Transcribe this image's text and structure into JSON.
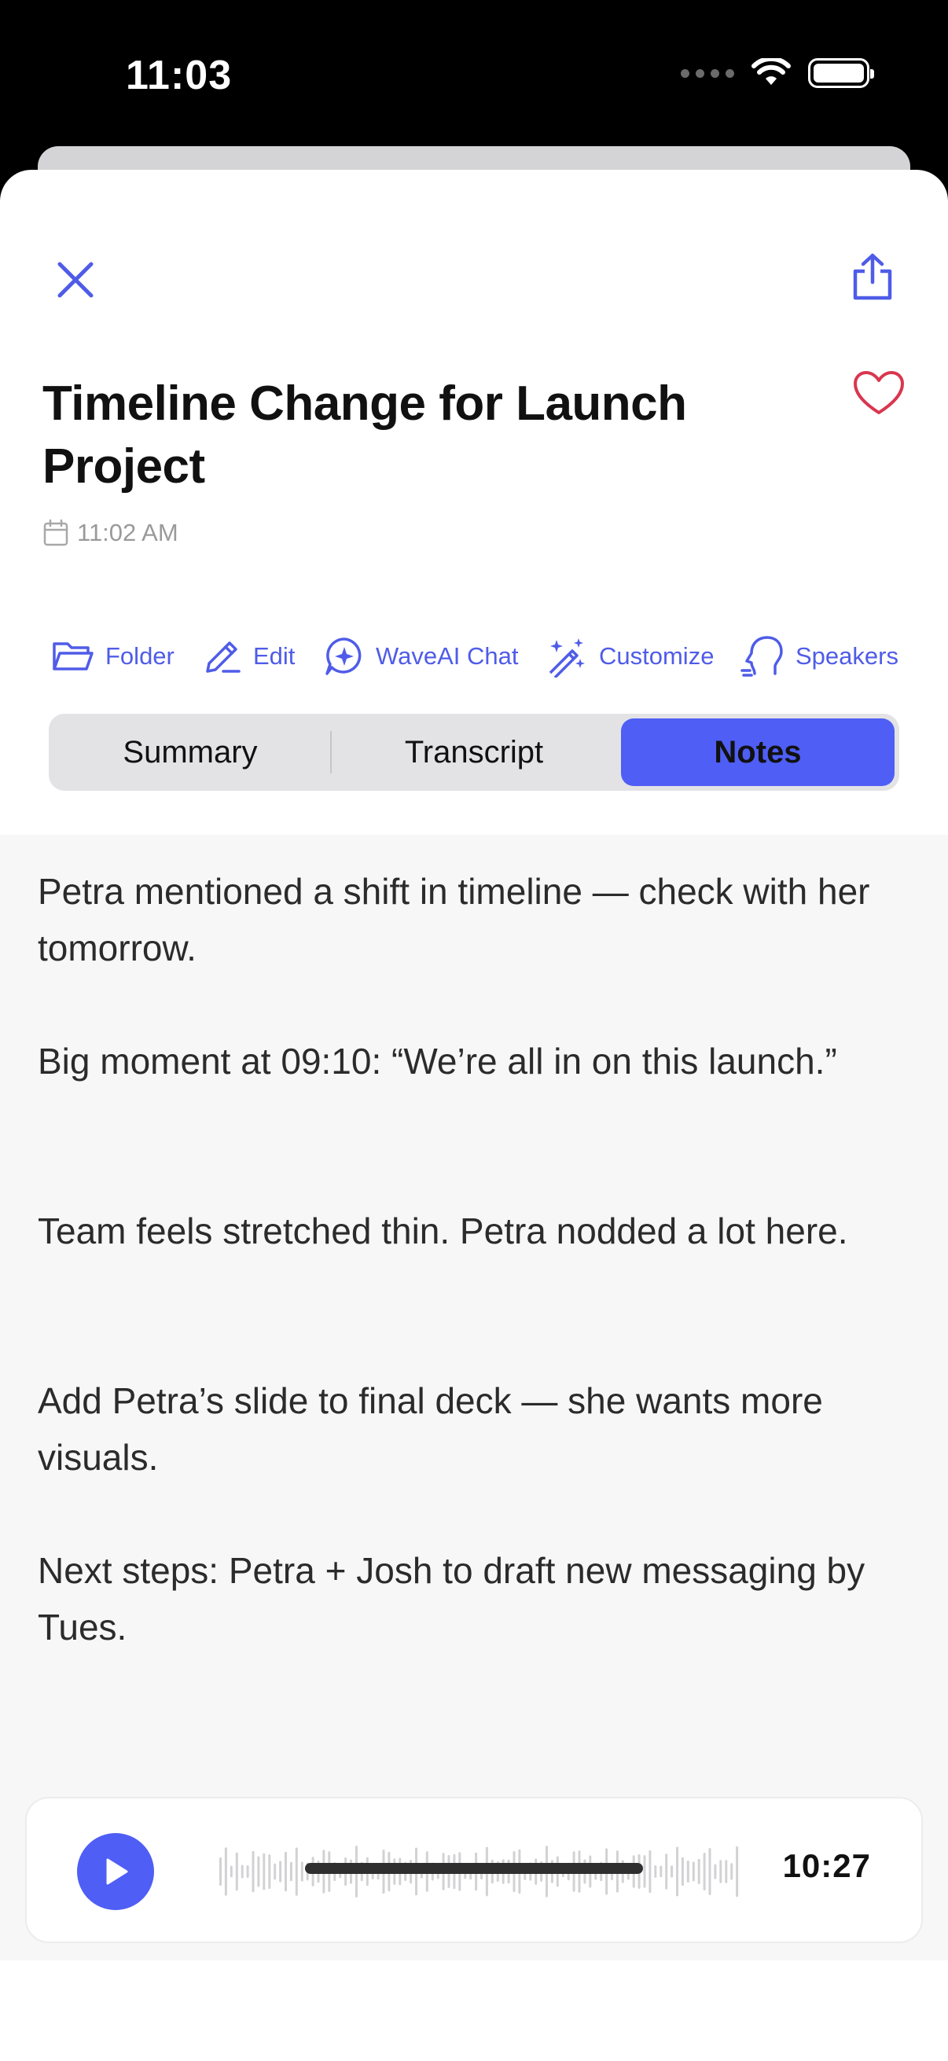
{
  "status_bar": {
    "time": "11:03"
  },
  "header": {
    "title": "Timeline Change for Launch Project",
    "time": "11:02 AM"
  },
  "actions": [
    {
      "id": "folder",
      "label": "Folder"
    },
    {
      "id": "edit",
      "label": "Edit"
    },
    {
      "id": "waveai",
      "label": "WaveAI Chat"
    },
    {
      "id": "customize",
      "label": "Customize"
    },
    {
      "id": "speakers",
      "label": "Speakers"
    }
  ],
  "tabs": [
    {
      "label": "Summary",
      "active": false
    },
    {
      "label": "Transcript",
      "active": false
    },
    {
      "label": "Notes",
      "active": true
    }
  ],
  "notes": [
    "Petra mentioned a shift in timeline — check with her tomorrow.",
    "Big moment at 09:10: “We’re all in on this launch.”",
    "Team feels stretched thin. Petra nodded a lot here.",
    "Add Petra’s slide to final deck — she wants more visuals.",
    "Next steps: Petra + Josh to draft new messaging by Tues."
  ],
  "player": {
    "duration": "10:27"
  },
  "colors": {
    "accent": "#4f5ef5",
    "heart": "#d9364f",
    "panel": "#f7f7f8"
  }
}
